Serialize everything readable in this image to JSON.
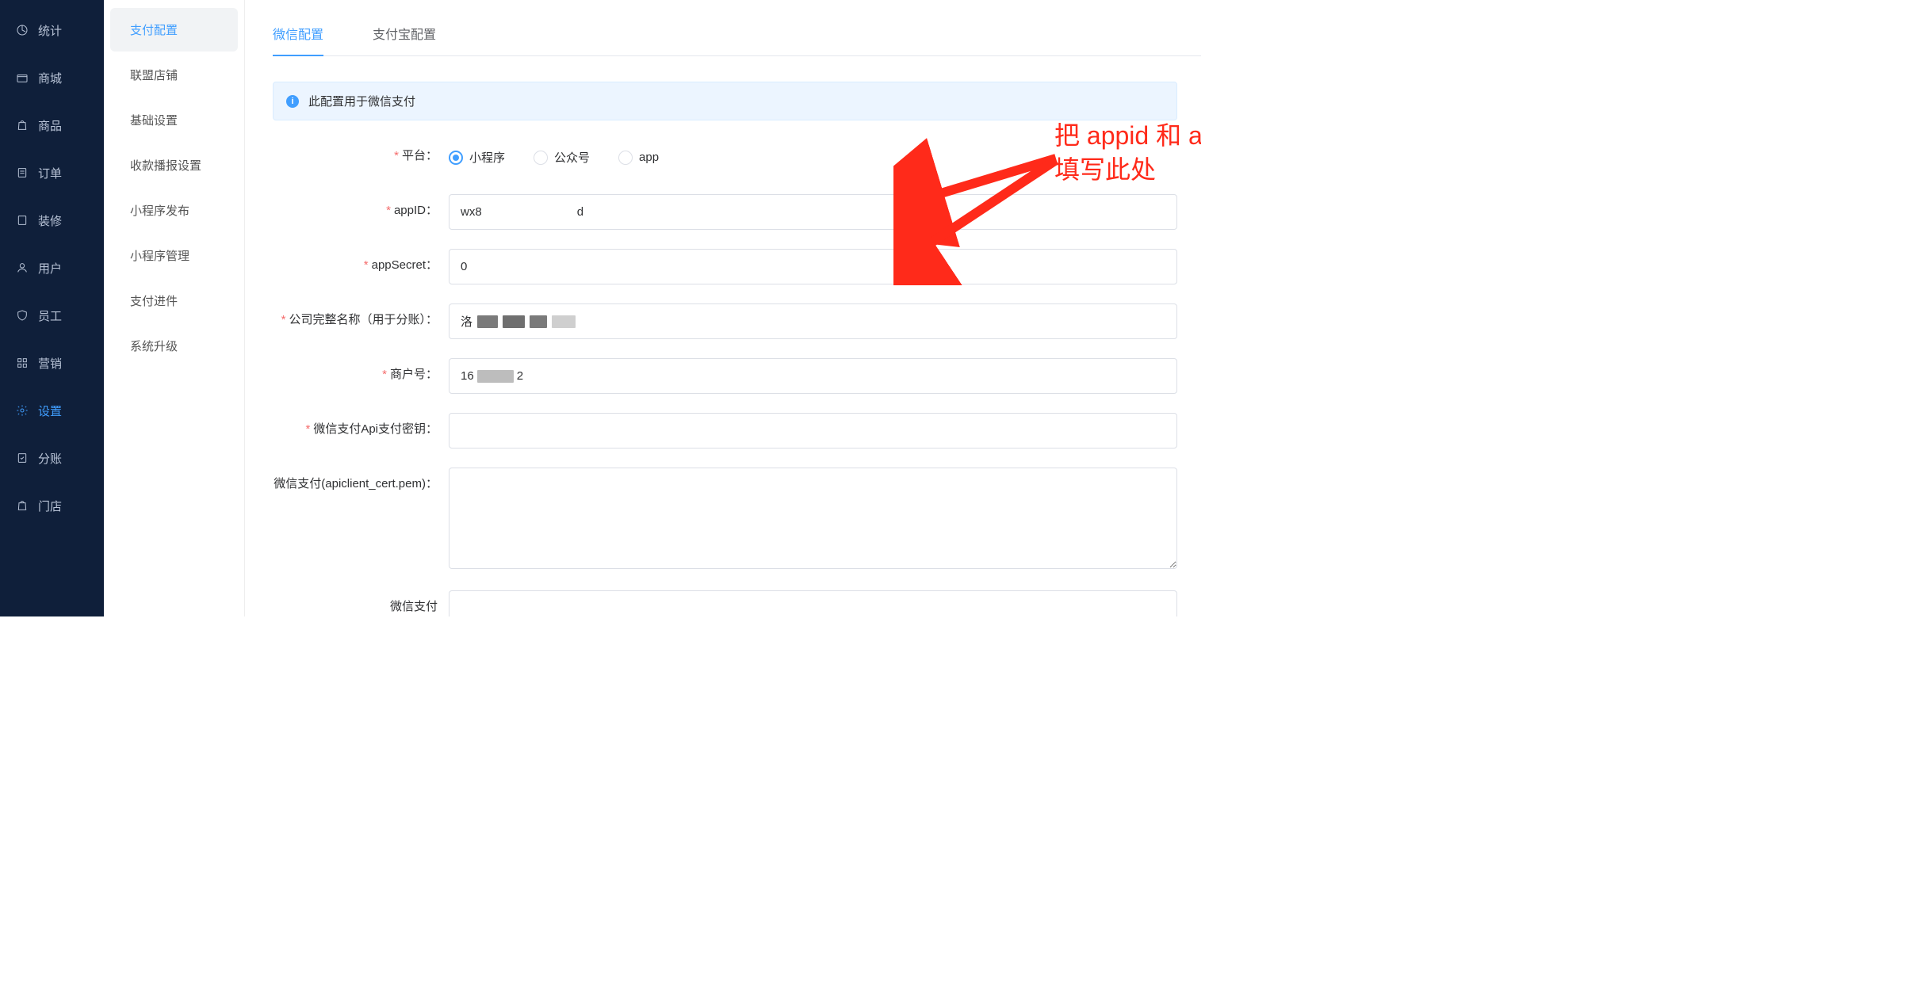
{
  "nav": {
    "items": [
      {
        "label": "统计",
        "icon": "stats"
      },
      {
        "label": "商城",
        "icon": "store"
      },
      {
        "label": "商品",
        "icon": "bag"
      },
      {
        "label": "订单",
        "icon": "order"
      },
      {
        "label": "装修",
        "icon": "layout"
      },
      {
        "label": "用户",
        "icon": "user"
      },
      {
        "label": "员工",
        "icon": "shield"
      },
      {
        "label": "营销",
        "icon": "grid"
      },
      {
        "label": "设置",
        "icon": "gear",
        "active": true
      },
      {
        "label": "分账",
        "icon": "split"
      },
      {
        "label": "门店",
        "icon": "shop"
      }
    ]
  },
  "subnav": {
    "items": [
      {
        "label": "支付配置",
        "active": true
      },
      {
        "label": "联盟店铺"
      },
      {
        "label": "基础设置"
      },
      {
        "label": "收款播报设置"
      },
      {
        "label": "小程序发布"
      },
      {
        "label": "小程序管理"
      },
      {
        "label": "支付进件"
      },
      {
        "label": "系统升级"
      }
    ]
  },
  "tabs": {
    "wechat": "微信配置",
    "alipay": "支付宝配置",
    "active": "wechat"
  },
  "alert": "此配置用于微信支付",
  "form": {
    "platform": {
      "label": "平台：",
      "options": {
        "mini": "小程序",
        "mp": "公众号",
        "app": "app"
      },
      "value": "mini"
    },
    "appid": {
      "label": "appID：",
      "value_prefix": "wx8",
      "value_suffix": "d"
    },
    "appsecret": {
      "label": "appSecret：",
      "value": "0"
    },
    "company": {
      "label": "公司完整名称（用于分账）：",
      "value_prefix": "洛"
    },
    "mchid": {
      "label": "商户号：",
      "value_prefix": "16",
      "value_suffix": "2"
    },
    "apikey": {
      "label": "微信支付Api支付密钥：",
      "value": ""
    },
    "cert": {
      "label": "微信支付(apiclient_cert.pem)：",
      "value": ""
    },
    "cert2": {
      "label": "微信支付",
      "value": ""
    }
  },
  "annotation": {
    "line1": "把 appid 和 appsecret",
    "line2": "填写此处"
  }
}
